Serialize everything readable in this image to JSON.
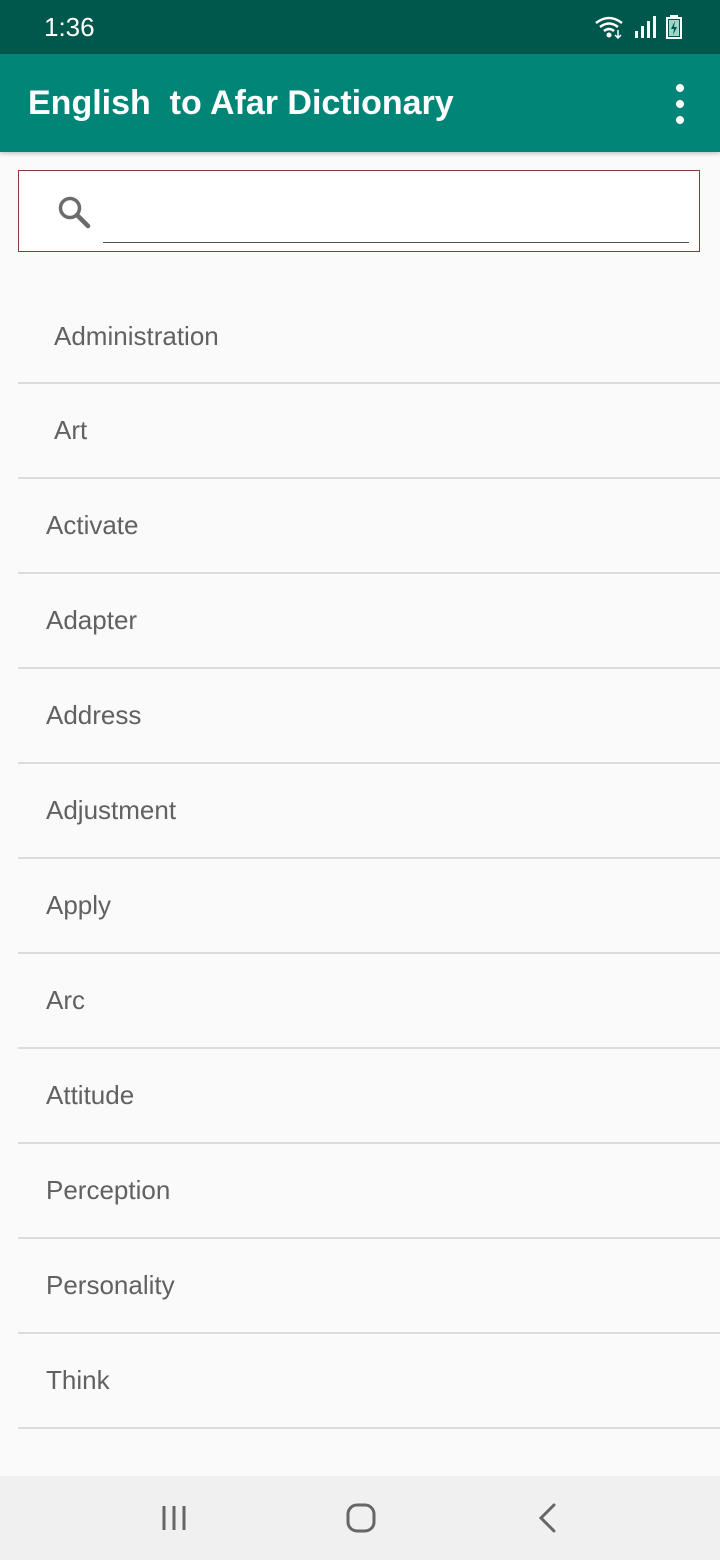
{
  "status_bar": {
    "time": "1:36",
    "icons": [
      "wifi-icon",
      "signal-icon",
      "battery-icon"
    ]
  },
  "app_bar": {
    "title": "English  to Afar Dictionary",
    "menu_icon": "overflow-menu-icon",
    "color": "#008577"
  },
  "search": {
    "icon": "search-icon",
    "value": "",
    "placeholder": ""
  },
  "words": [
    {
      "label": "Administration",
      "indent": 36
    },
    {
      "label": "Art",
      "indent": 36
    },
    {
      "label": "Activate",
      "indent": 28
    },
    {
      "label": "Adapter",
      "indent": 28
    },
    {
      "label": "Address",
      "indent": 28
    },
    {
      "label": "Adjustment",
      "indent": 28
    },
    {
      "label": "Apply",
      "indent": 28
    },
    {
      "label": "Arc",
      "indent": 28
    },
    {
      "label": "Attitude",
      "indent": 28
    },
    {
      "label": "Perception",
      "indent": 28
    },
    {
      "label": "Personality",
      "indent": 28
    },
    {
      "label": "Think",
      "indent": 28
    }
  ],
  "nav_bar": {
    "buttons": [
      "recent-apps-icon",
      "home-icon",
      "back-icon"
    ]
  }
}
